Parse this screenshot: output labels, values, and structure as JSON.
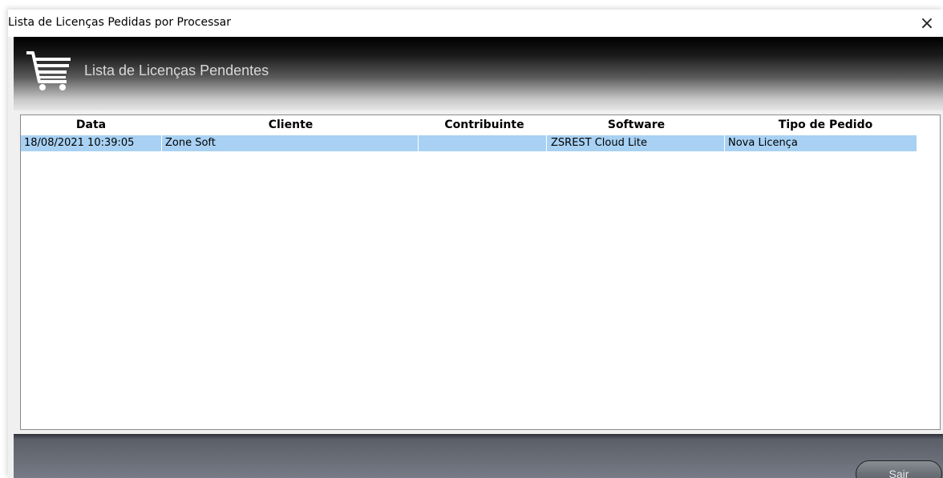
{
  "window": {
    "title": "Lista de Licenças Pedidas por Processar",
    "close_glyph": "×"
  },
  "banner": {
    "icon": "shopping-cart-icon",
    "title": "Lista de Licenças Pendentes"
  },
  "table": {
    "columns": [
      "Data",
      "Cliente",
      "Contribuinte",
      "Software",
      "Tipo de Pedido"
    ],
    "rows": [
      {
        "data": "18/08/2021 10:39:05",
        "cliente": "Zone Soft",
        "contribuinte": "",
        "software": "ZSREST Cloud Lite",
        "tipo": "Nova Licença",
        "selected": true
      }
    ]
  },
  "footer": {
    "exit_label": "Sair"
  },
  "colors": {
    "selection": "#a8d1f3",
    "footer": "#767b85"
  }
}
